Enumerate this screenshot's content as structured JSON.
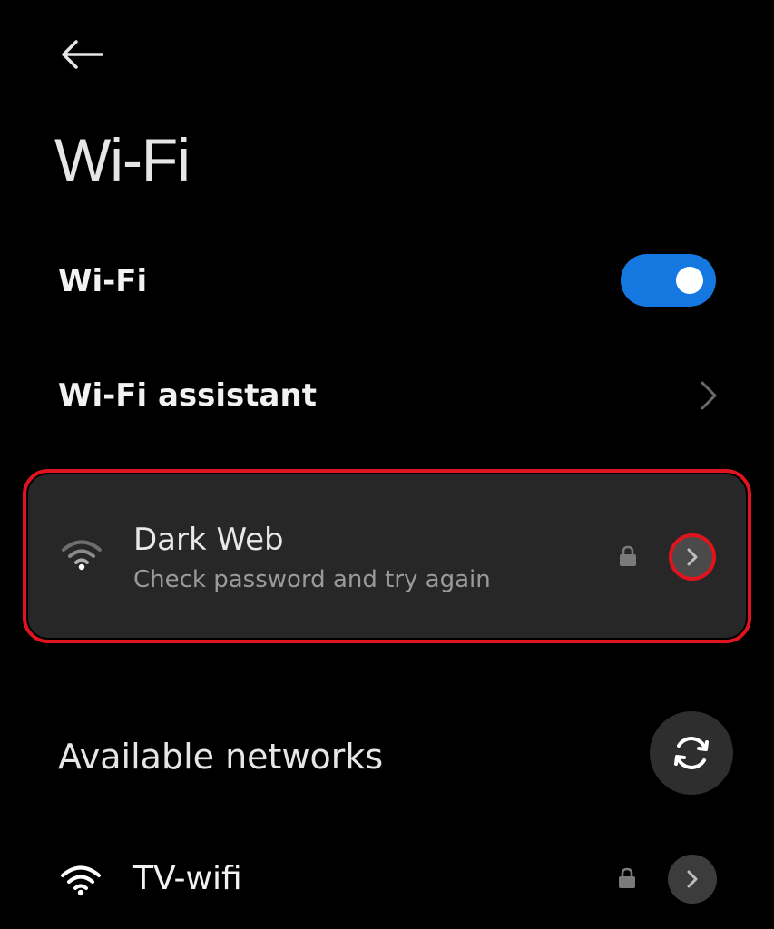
{
  "header": {
    "back_icon": "arrow-left-icon",
    "title": "Wi-Fi"
  },
  "wifi_toggle": {
    "label": "Wi-Fi",
    "enabled": true,
    "accent_color": "#1578e0"
  },
  "assistant": {
    "label": "Wi-Fi assistant",
    "chevron_icon": "chevron-right-icon"
  },
  "current_network": {
    "name": "Dark Web",
    "status": "Check password and try again",
    "signal_icon": "wifi-signal-icon",
    "lock_icon": "lock-icon",
    "detail_icon": "chevron-right-icon",
    "highlight_color": "#e0141e"
  },
  "available": {
    "title": "Available networks",
    "refresh_icon": "refresh-icon",
    "networks": [
      {
        "name": "TV-wifi",
        "signal_icon": "wifi-signal-icon",
        "lock_icon": "lock-icon",
        "detail_icon": "chevron-right-icon"
      }
    ]
  }
}
